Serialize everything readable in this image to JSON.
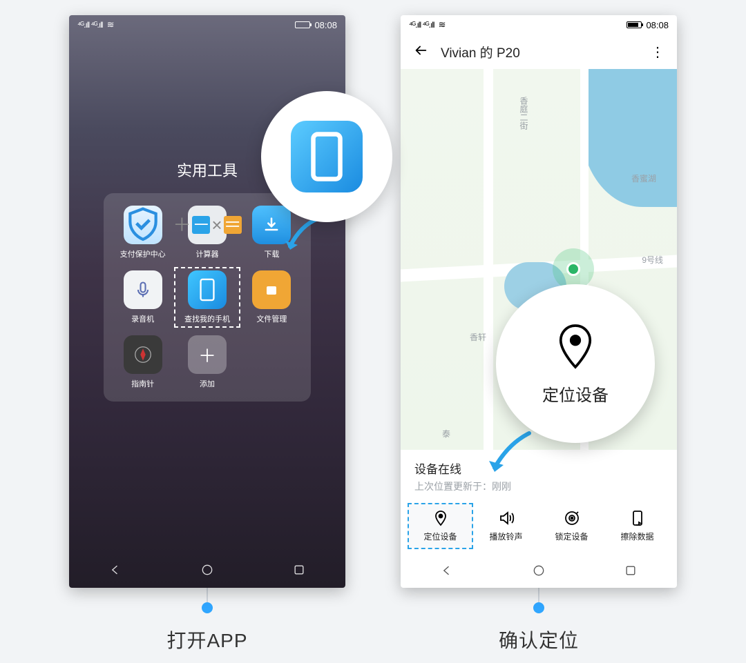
{
  "status": {
    "time": "08:08",
    "signal_left": "⁴ᴳ.ıll ⁴ᴳ.ıll",
    "wifi": "≋"
  },
  "phone1": {
    "folder_title": "实用工具",
    "apps": [
      {
        "label": "支付保护中心"
      },
      {
        "label": "计算器"
      },
      {
        "label": "下载"
      },
      {
        "label": "录音机"
      },
      {
        "label": "查找我的手机"
      },
      {
        "label": "文件管理"
      },
      {
        "label": "指南针"
      },
      {
        "label": "添加"
      }
    ],
    "step_caption": "打开APP"
  },
  "phone2": {
    "device_name": "Vivian 的 P20",
    "map_labels": {
      "street1": "香庭二街",
      "lake": "香蜜湖",
      "line": "9号线",
      "street2": "香轩",
      "area": "泰"
    },
    "status_title": "设备在线",
    "status_sub": "上次位置更新于：刚刚",
    "actions": [
      {
        "label": "定位设备"
      },
      {
        "label": "播放铃声"
      },
      {
        "label": "锁定设备"
      },
      {
        "label": "擦除数据"
      }
    ],
    "callout_label": "定位设备",
    "step_caption": "确认定位"
  }
}
